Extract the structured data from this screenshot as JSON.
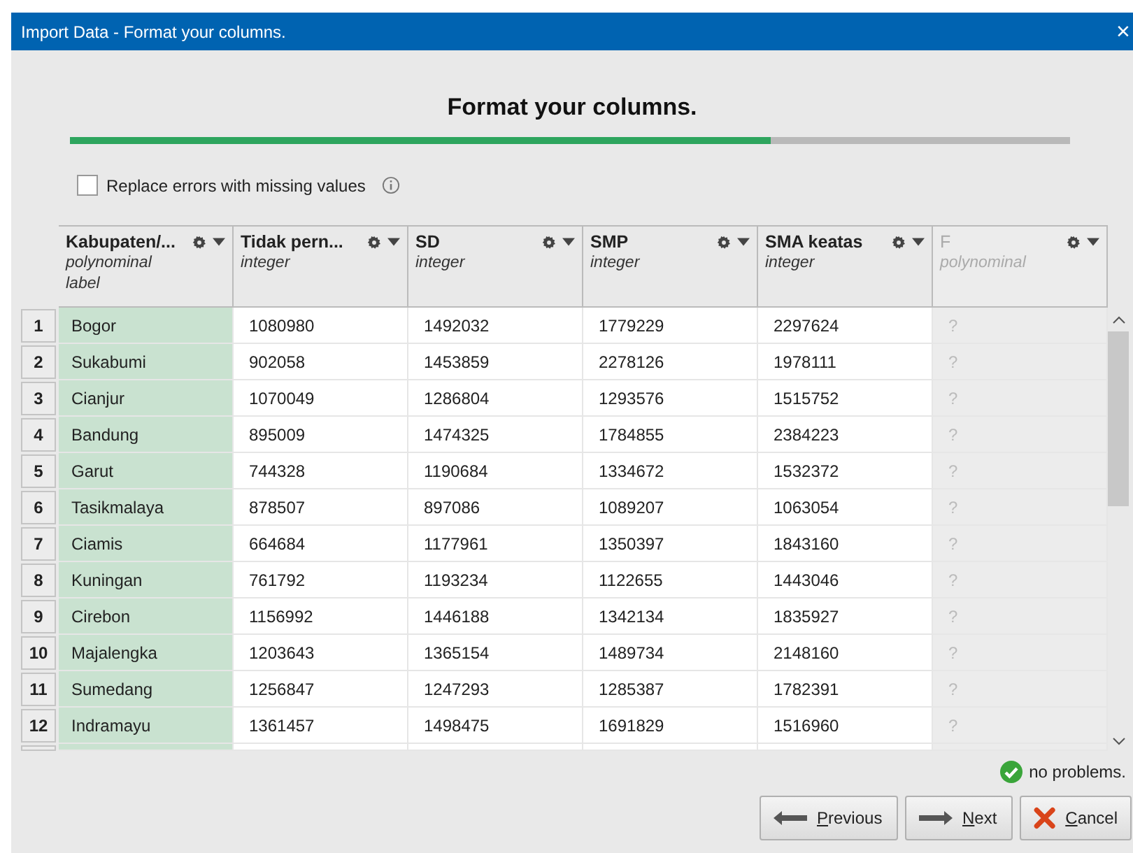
{
  "window": {
    "title": "Import Data - Format your columns.",
    "close": "×"
  },
  "heading": "Format your columns.",
  "progress": {
    "level": 0.7
  },
  "replace_errors": {
    "label": "Replace errors with missing values",
    "checked": false
  },
  "columns": [
    {
      "name": "Kabupaten/...",
      "type": "polynominal",
      "role": "label",
      "disabled": false
    },
    {
      "name": "Tidak pern...",
      "type": "integer",
      "disabled": false
    },
    {
      "name": "SD",
      "type": "integer",
      "disabled": false
    },
    {
      "name": "SMP",
      "type": "integer",
      "disabled": false
    },
    {
      "name": "SMA keatas",
      "type": "integer",
      "disabled": false
    },
    {
      "name": "F",
      "type": "polynominal",
      "disabled": true
    }
  ],
  "rows": [
    {
      "index": "1",
      "cells": [
        "Bogor",
        "1080980",
        "1492032",
        "1779229",
        "2297624",
        "?"
      ]
    },
    {
      "index": "2",
      "cells": [
        "Sukabumi",
        "902058",
        "1453859",
        "2278126",
        "1978111",
        "?"
      ]
    },
    {
      "index": "3",
      "cells": [
        "Cianjur",
        "1070049",
        "1286804",
        "1293576",
        "1515752",
        "?"
      ]
    },
    {
      "index": "4",
      "cells": [
        "Bandung",
        "895009",
        "1474325",
        "1784855",
        "2384223",
        "?"
      ]
    },
    {
      "index": "5",
      "cells": [
        "Garut",
        "744328",
        "1190684",
        "1334672",
        "1532372",
        "?"
      ]
    },
    {
      "index": "6",
      "cells": [
        "Tasikmalaya",
        "878507",
        "897086",
        "1089207",
        "1063054",
        "?"
      ]
    },
    {
      "index": "7",
      "cells": [
        "Ciamis",
        "664684",
        "1177961",
        "1350397",
        "1843160",
        "?"
      ]
    },
    {
      "index": "8",
      "cells": [
        "Kuningan",
        "761792",
        "1193234",
        "1122655",
        "1443046",
        "?"
      ]
    },
    {
      "index": "9",
      "cells": [
        "Cirebon",
        "1156992",
        "1446188",
        "1342134",
        "1835927",
        "?"
      ]
    },
    {
      "index": "10",
      "cells": [
        "Majalengka",
        "1203643",
        "1365154",
        "1489734",
        "2148160",
        "?"
      ]
    },
    {
      "index": "11",
      "cells": [
        "Sumedang",
        "1256847",
        "1247293",
        "1285387",
        "1782391",
        "?"
      ]
    },
    {
      "index": "12",
      "cells": [
        "Indramayu",
        "1361457",
        "1498475",
        "1691829",
        "1516960",
        "?"
      ]
    }
  ],
  "status": "no problems.",
  "buttons": [
    {
      "kind": "previous",
      "label": "Previous"
    },
    {
      "kind": "next",
      "label": "Next"
    },
    {
      "kind": "cancel",
      "label": "Cancel"
    }
  ]
}
